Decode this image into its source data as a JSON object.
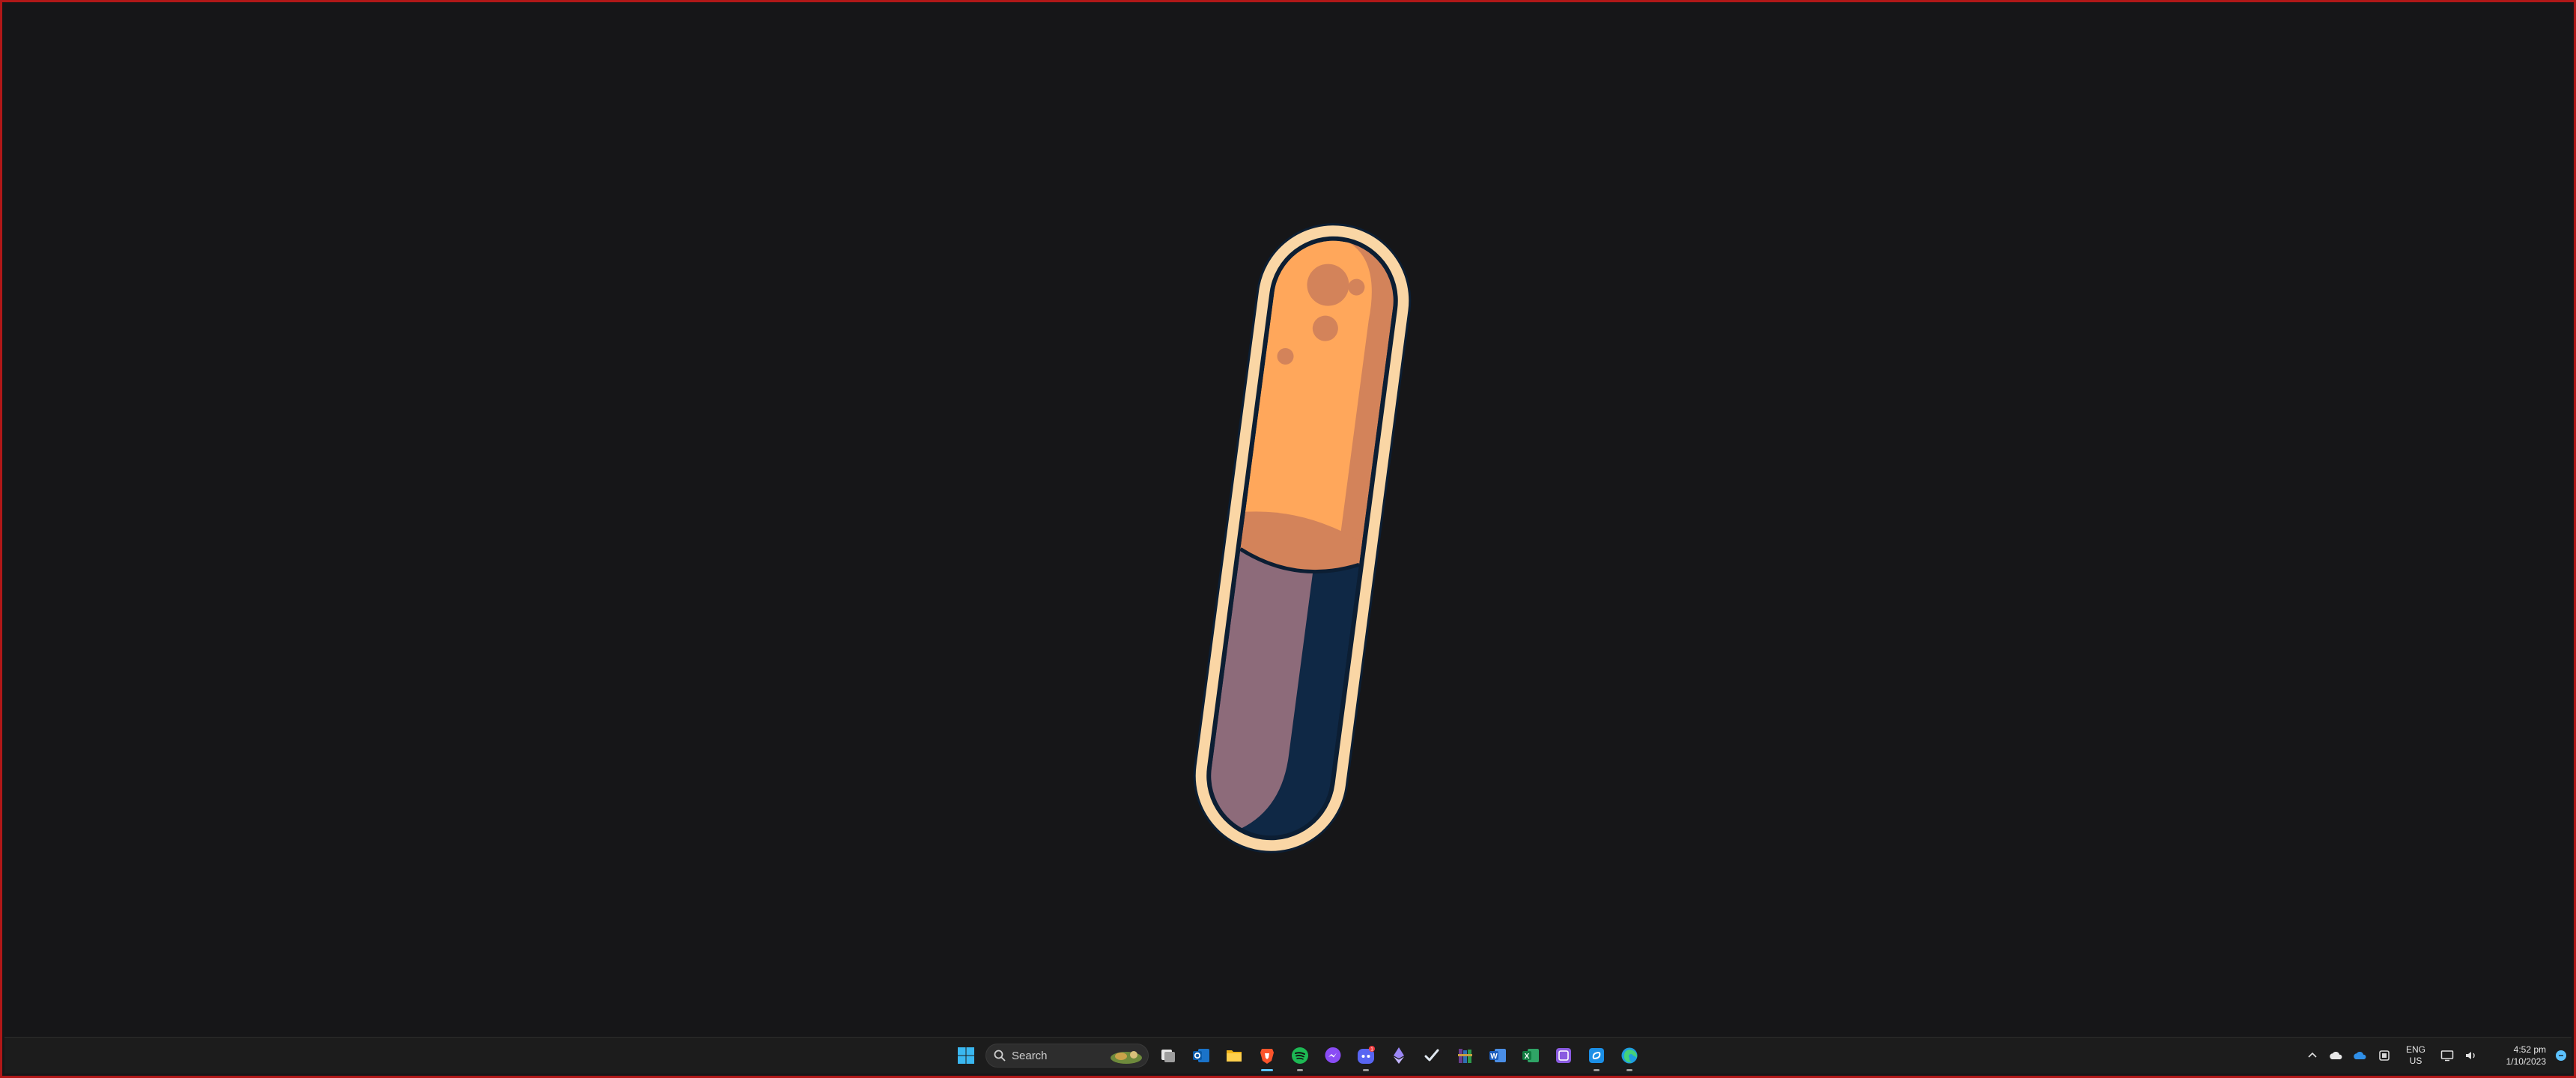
{
  "desktop": {
    "wallpaper": "pill-capsule-illustration",
    "colors": {
      "background": "#161618",
      "outline": "#fad6a5",
      "orange_light": "#ffa75b",
      "orange_dark": "#d3835a",
      "purple": "#8d6b7a",
      "navy": "#0f2845",
      "stroke": "#0c1e33"
    }
  },
  "taskbar": {
    "search": {
      "placeholder": "Search"
    },
    "apps": [
      {
        "name": "start-icon"
      },
      {
        "name": "task-view-icon"
      },
      {
        "name": "outlook-icon"
      },
      {
        "name": "file-explorer-icon"
      },
      {
        "name": "brave-browser-icon",
        "active": true
      },
      {
        "name": "spotify-icon"
      },
      {
        "name": "messenger-icon"
      },
      {
        "name": "discord-icon",
        "badge": "1"
      },
      {
        "name": "ethereum-wallet-icon"
      },
      {
        "name": "steam-icon"
      },
      {
        "name": "winrar-icon"
      },
      {
        "name": "word-icon"
      },
      {
        "name": "excel-icon"
      },
      {
        "name": "onenote-icon"
      },
      {
        "name": "snipping-tool-icon"
      },
      {
        "name": "edge-icon"
      }
    ],
    "tray": {
      "language_line1": "ENG",
      "language_line2": "US",
      "time": "4:52 pm",
      "date": "1/10/2023"
    }
  }
}
